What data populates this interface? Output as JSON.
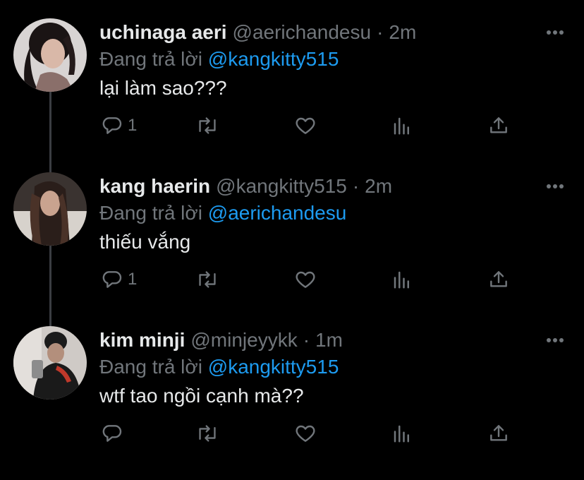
{
  "tweets": [
    {
      "name": "uchinaga aeri",
      "handle": "@aerichandesu",
      "dot": "·",
      "time": "2m",
      "reply_prefix": "Đang trả lời",
      "reply_to": "@kangkitty515",
      "text": "lại làm sao???",
      "reply_count": "1"
    },
    {
      "name": "kang haerin",
      "handle": "@kangkitty515",
      "dot": "·",
      "time": "2m",
      "reply_prefix": "Đang trả lời",
      "reply_to": "@aerichandesu",
      "text": "thiếu vắng",
      "reply_count": "1"
    },
    {
      "name": "kim minji",
      "handle": "@minjeyykk",
      "dot": "·",
      "time": "1m",
      "reply_prefix": "Đang trả lời",
      "reply_to": "@kangkitty515",
      "text": "wtf tao ngồi cạnh mà??",
      "reply_count": ""
    }
  ],
  "icons": {
    "reply": "reply-icon",
    "retweet": "retweet-icon",
    "like": "heart-icon",
    "views": "views-icon",
    "share": "share-icon",
    "more": "more-icon"
  },
  "colors": {
    "background": "#000000",
    "primary_text": "#e7e9ea",
    "secondary_text": "#71767b",
    "accent": "#1d9bf0",
    "thread_line": "#3a3d42"
  }
}
